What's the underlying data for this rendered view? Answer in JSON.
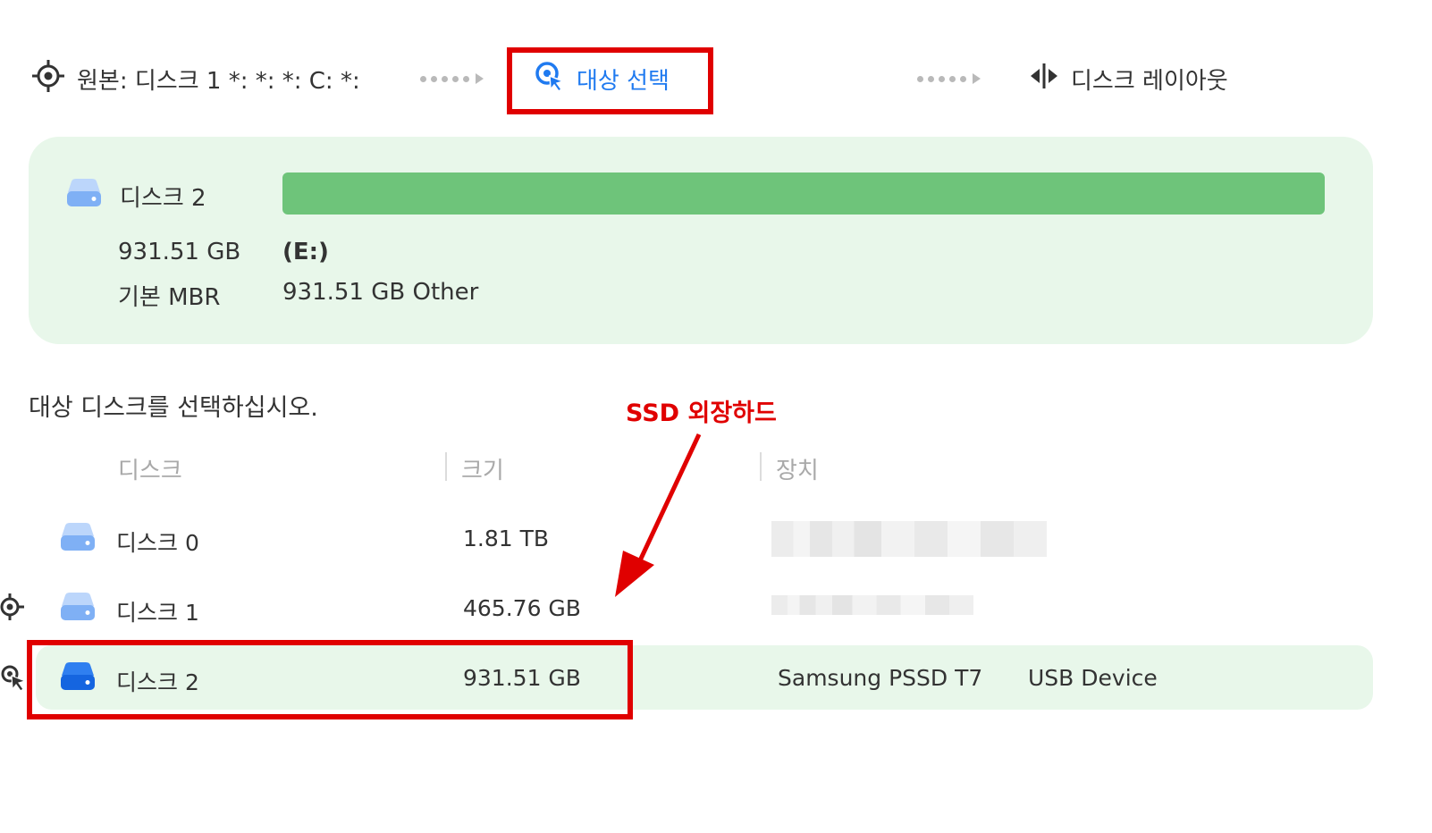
{
  "steps": {
    "source_label": "원본: 디스크 1 *: *: *: C: *:",
    "target_label": "대상 선택",
    "layout_label": "디스크 레이아웃"
  },
  "summary": {
    "disk_name": "디스크 2",
    "size": "931.51 GB",
    "type": "기본 MBR",
    "partition_letter": "(E:)",
    "partition_info": "931.51 GB Other"
  },
  "instruction": "대상 디스크를 선택하십시오.",
  "annotation": "SSD 외장하드",
  "table": {
    "headers": [
      "디스크",
      "크기",
      "장치"
    ],
    "rows": [
      {
        "name": "디스크 0",
        "size": "1.81 TB",
        "device": "",
        "vendor": ""
      },
      {
        "name": "디스크 1",
        "size": "465.76 GB",
        "device": "",
        "vendor": ""
      },
      {
        "name": "디스크 2",
        "size": "931.51 GB",
        "device": "Samsung  PSSD T7",
        "vendor": "USB Device"
      }
    ]
  },
  "colors": {
    "accent": "#1f7af0",
    "panel_bg": "#e8f7ea",
    "used_bar": "#6ec47a",
    "highlight_red": "#e00000"
  }
}
